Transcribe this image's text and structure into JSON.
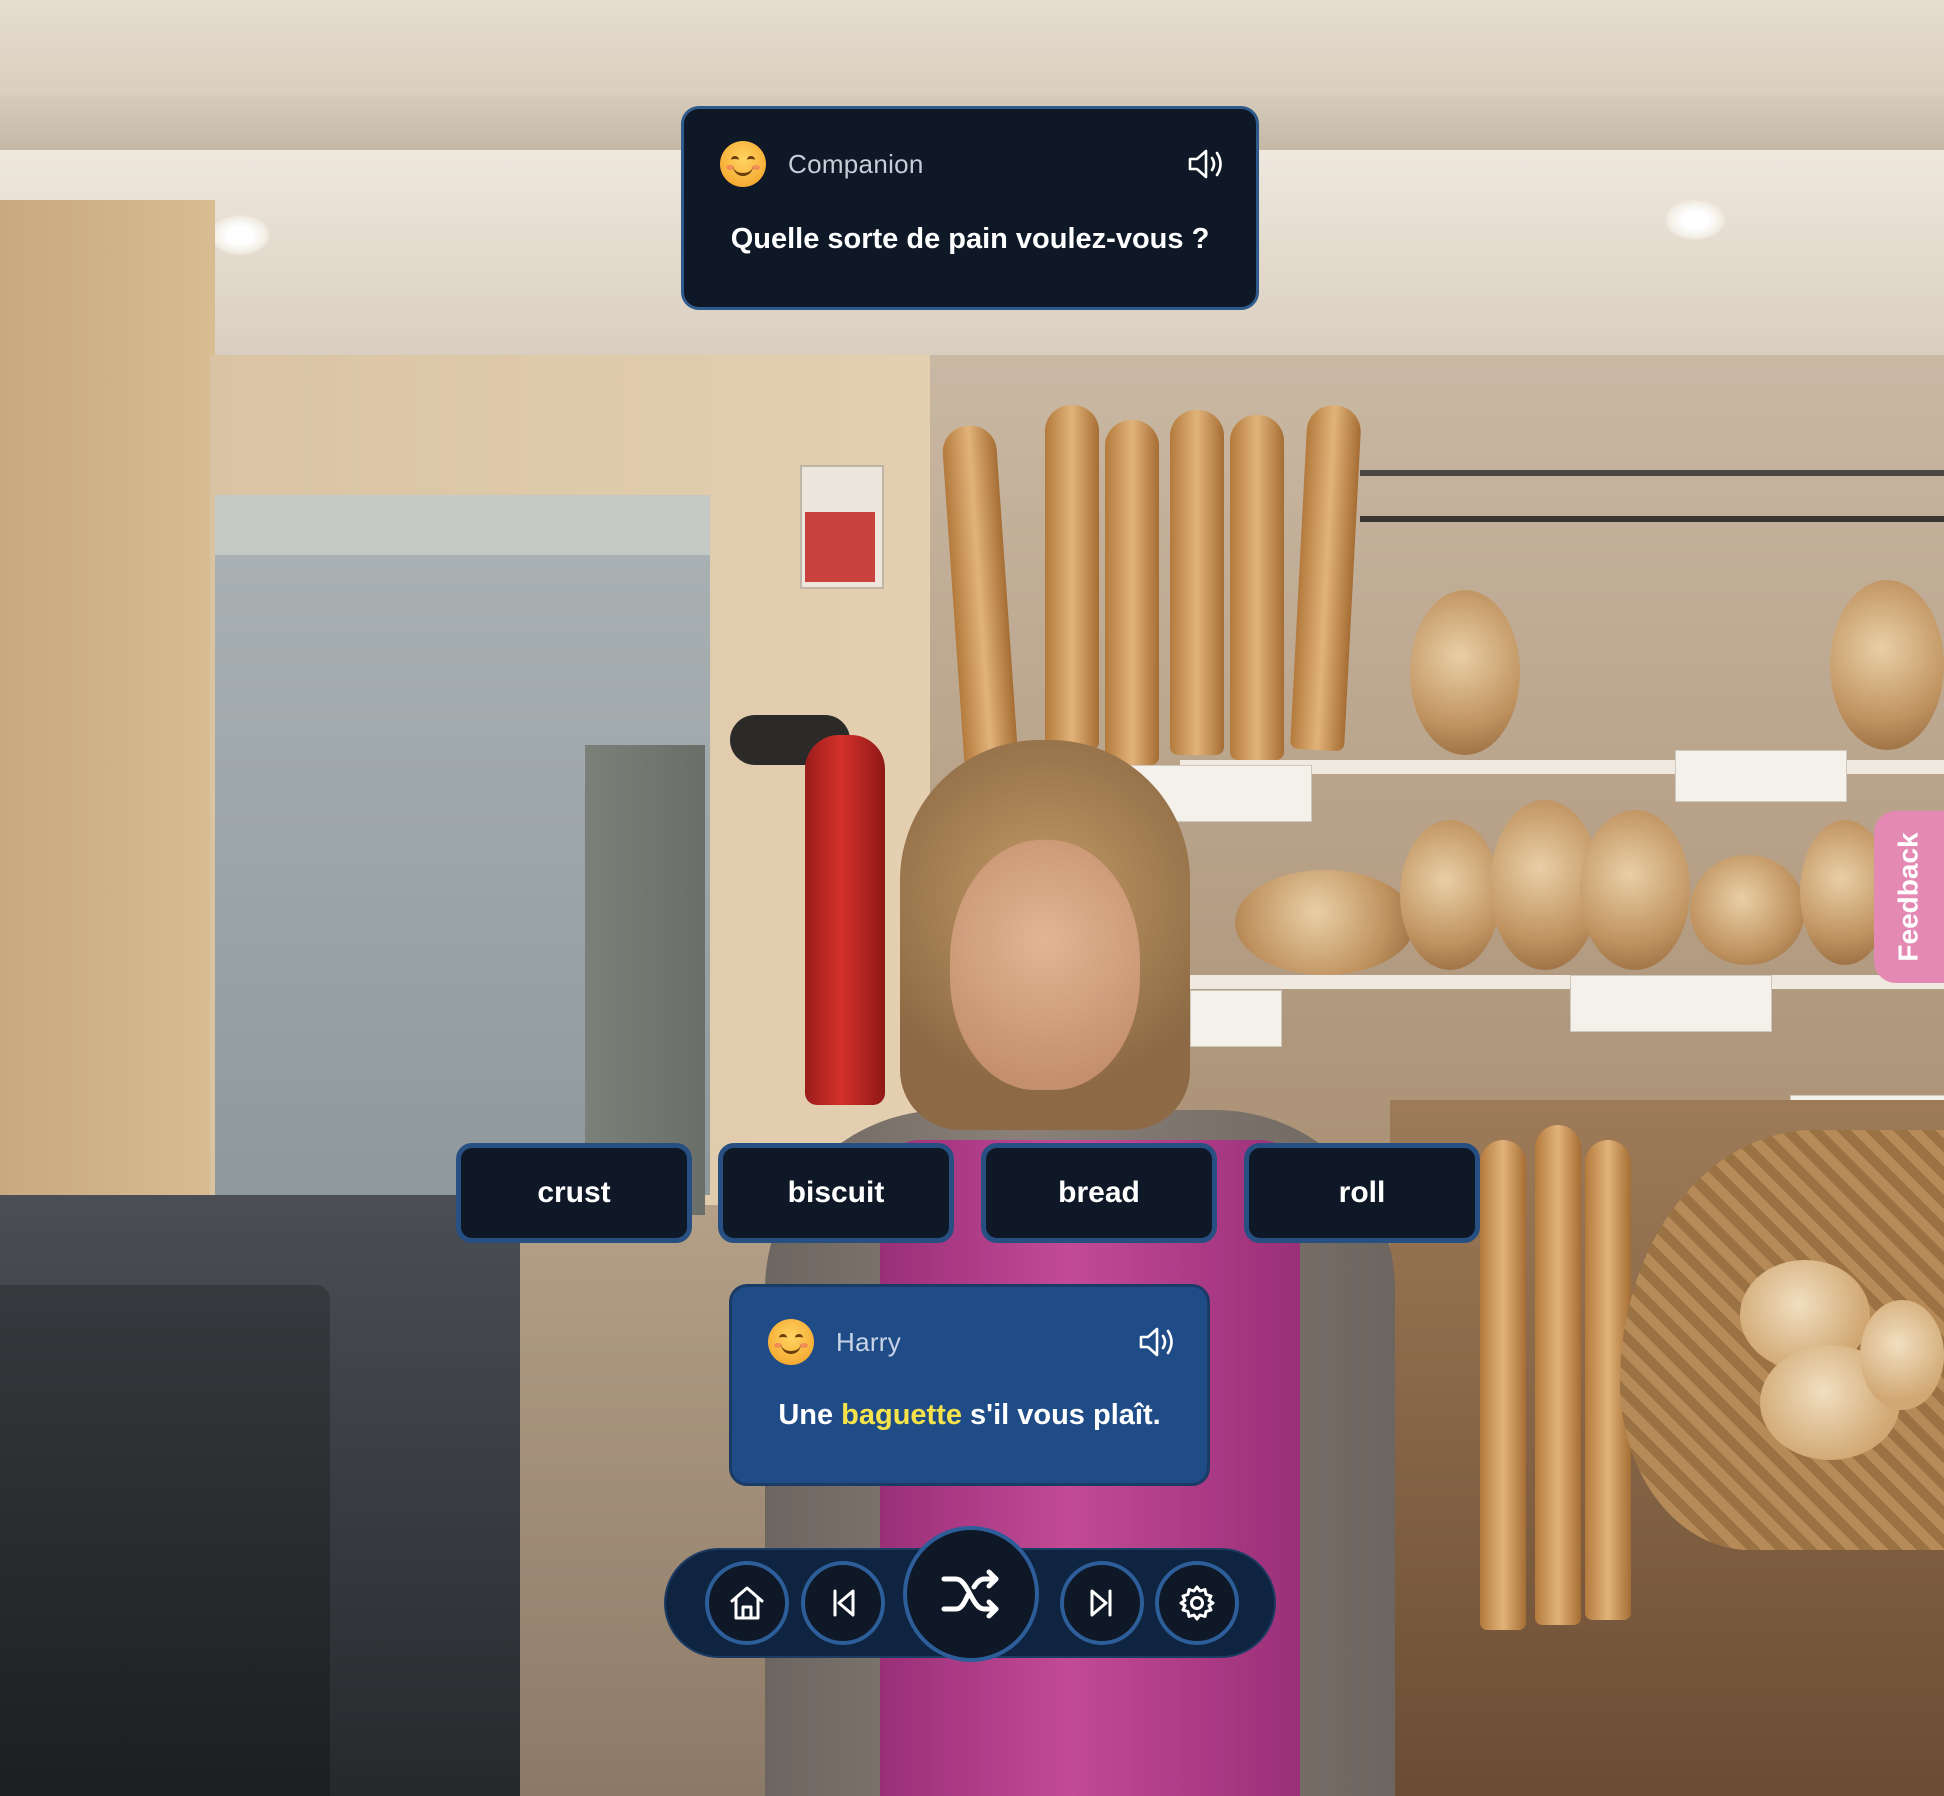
{
  "companion_card": {
    "speaker": "Companion",
    "prompt": "Quelle sorte de pain voulez-vous ?",
    "avatar_icon": "smiling-face-emoji",
    "audio_icon": "speaker-icon",
    "background_color": "#0e1826",
    "border_color": "#2f5a8c"
  },
  "answer_choices": [
    {
      "label": "crust"
    },
    {
      "label": "biscuit"
    },
    {
      "label": "bread"
    },
    {
      "label": "roll"
    }
  ],
  "user_card": {
    "speaker": "Harry",
    "text_before": "Une ",
    "highlighted_word": "baguette",
    "text_after": " s'il vous plaît.",
    "avatar_icon": "smiling-face-emoji",
    "audio_icon": "speaker-icon",
    "background_color": "#1f4c86",
    "highlight_color": "#f6e24a"
  },
  "nav_controls": [
    {
      "name": "home",
      "icon": "home-icon"
    },
    {
      "name": "previous",
      "icon": "skip-back-icon"
    },
    {
      "name": "shuffle",
      "icon": "shuffle-icon"
    },
    {
      "name": "next",
      "icon": "skip-forward-icon"
    },
    {
      "name": "settings",
      "icon": "gear-icon"
    }
  ],
  "feedback_tab": {
    "label": "Feedback",
    "color": "#e389b3"
  },
  "background_scene": "bakery-shop-photo"
}
